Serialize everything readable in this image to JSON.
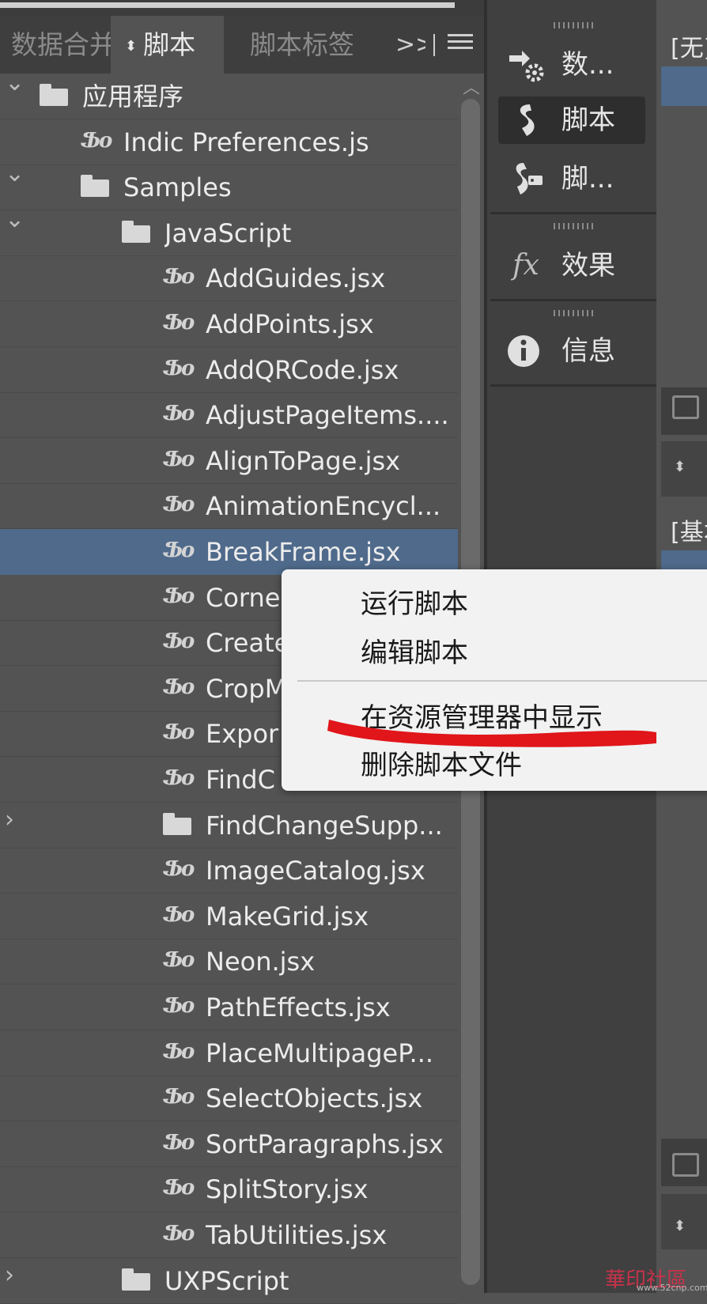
{
  "tabs": {
    "data_merge": "数据合并",
    "scripts": "脚本",
    "script_label": "脚本标签",
    "more": ">>"
  },
  "tree": [
    {
      "label": "应用程序",
      "type": "folder",
      "expanded": true,
      "level": 0
    },
    {
      "label": "Indic Preferences.js",
      "type": "script",
      "level": 1
    },
    {
      "label": "Samples",
      "type": "folder",
      "expanded": true,
      "level": 1
    },
    {
      "label": "JavaScript",
      "type": "folder",
      "expanded": true,
      "level": 2
    },
    {
      "label": "AddGuides.jsx",
      "type": "script",
      "level": 3
    },
    {
      "label": "AddPoints.jsx",
      "type": "script",
      "level": 3
    },
    {
      "label": "AddQRCode.jsx",
      "type": "script",
      "level": 3
    },
    {
      "label": "AdjustPageItems....",
      "type": "script",
      "level": 3
    },
    {
      "label": "AlignToPage.jsx",
      "type": "script",
      "level": 3
    },
    {
      "label": "AnimationEncycl...",
      "type": "script",
      "level": 3
    },
    {
      "label": "BreakFrame.jsx",
      "type": "script",
      "level": 3,
      "selected": true
    },
    {
      "label": "Corne",
      "type": "script",
      "level": 3
    },
    {
      "label": "Create",
      "type": "script",
      "level": 3
    },
    {
      "label": "CropM",
      "type": "script",
      "level": 3
    },
    {
      "label": "Expor",
      "type": "script",
      "level": 3
    },
    {
      "label": "FindC",
      "type": "script",
      "level": 3
    },
    {
      "label": "FindChangeSupp...",
      "type": "folder",
      "expanded": false,
      "level": 3
    },
    {
      "label": "ImageCatalog.jsx",
      "type": "script",
      "level": 3
    },
    {
      "label": "MakeGrid.jsx",
      "type": "script",
      "level": 3
    },
    {
      "label": "Neon.jsx",
      "type": "script",
      "level": 3
    },
    {
      "label": "PathEffects.jsx",
      "type": "script",
      "level": 3
    },
    {
      "label": "PlaceMultipageP...",
      "type": "script",
      "level": 3
    },
    {
      "label": "SelectObjects.jsx",
      "type": "script",
      "level": 3
    },
    {
      "label": "SortParagraphs.jsx",
      "type": "script",
      "level": 3
    },
    {
      "label": "SplitStory.jsx",
      "type": "script",
      "level": 3
    },
    {
      "label": "TabUtilities.jsx",
      "type": "script",
      "level": 3
    },
    {
      "label": "UXPScript",
      "type": "folder",
      "expanded": false,
      "level": 2
    }
  ],
  "dock": [
    {
      "label": "数...",
      "icon": "data-merge-icon"
    },
    {
      "label": "脚本",
      "icon": "scripts-icon",
      "active": true
    },
    {
      "label": "脚...",
      "icon": "script-label-icon"
    },
    {
      "label": "效果",
      "icon": "fx-icon"
    },
    {
      "label": "信息",
      "icon": "info-icon"
    }
  ],
  "right_panel": {
    "none_swatch": "[无]",
    "basic_style": "[基本"
  },
  "context_menu": {
    "run": "运行脚本",
    "edit": "编辑脚本",
    "reveal": "在资源管理器中显示",
    "delete": "删除脚本文件"
  },
  "watermark": {
    "text": "華印社區",
    "url": "www.52cnp.com"
  },
  "colors": {
    "panel_bg": "#535353",
    "selection": "#4f6a8b",
    "annotation": "#e0161a"
  }
}
